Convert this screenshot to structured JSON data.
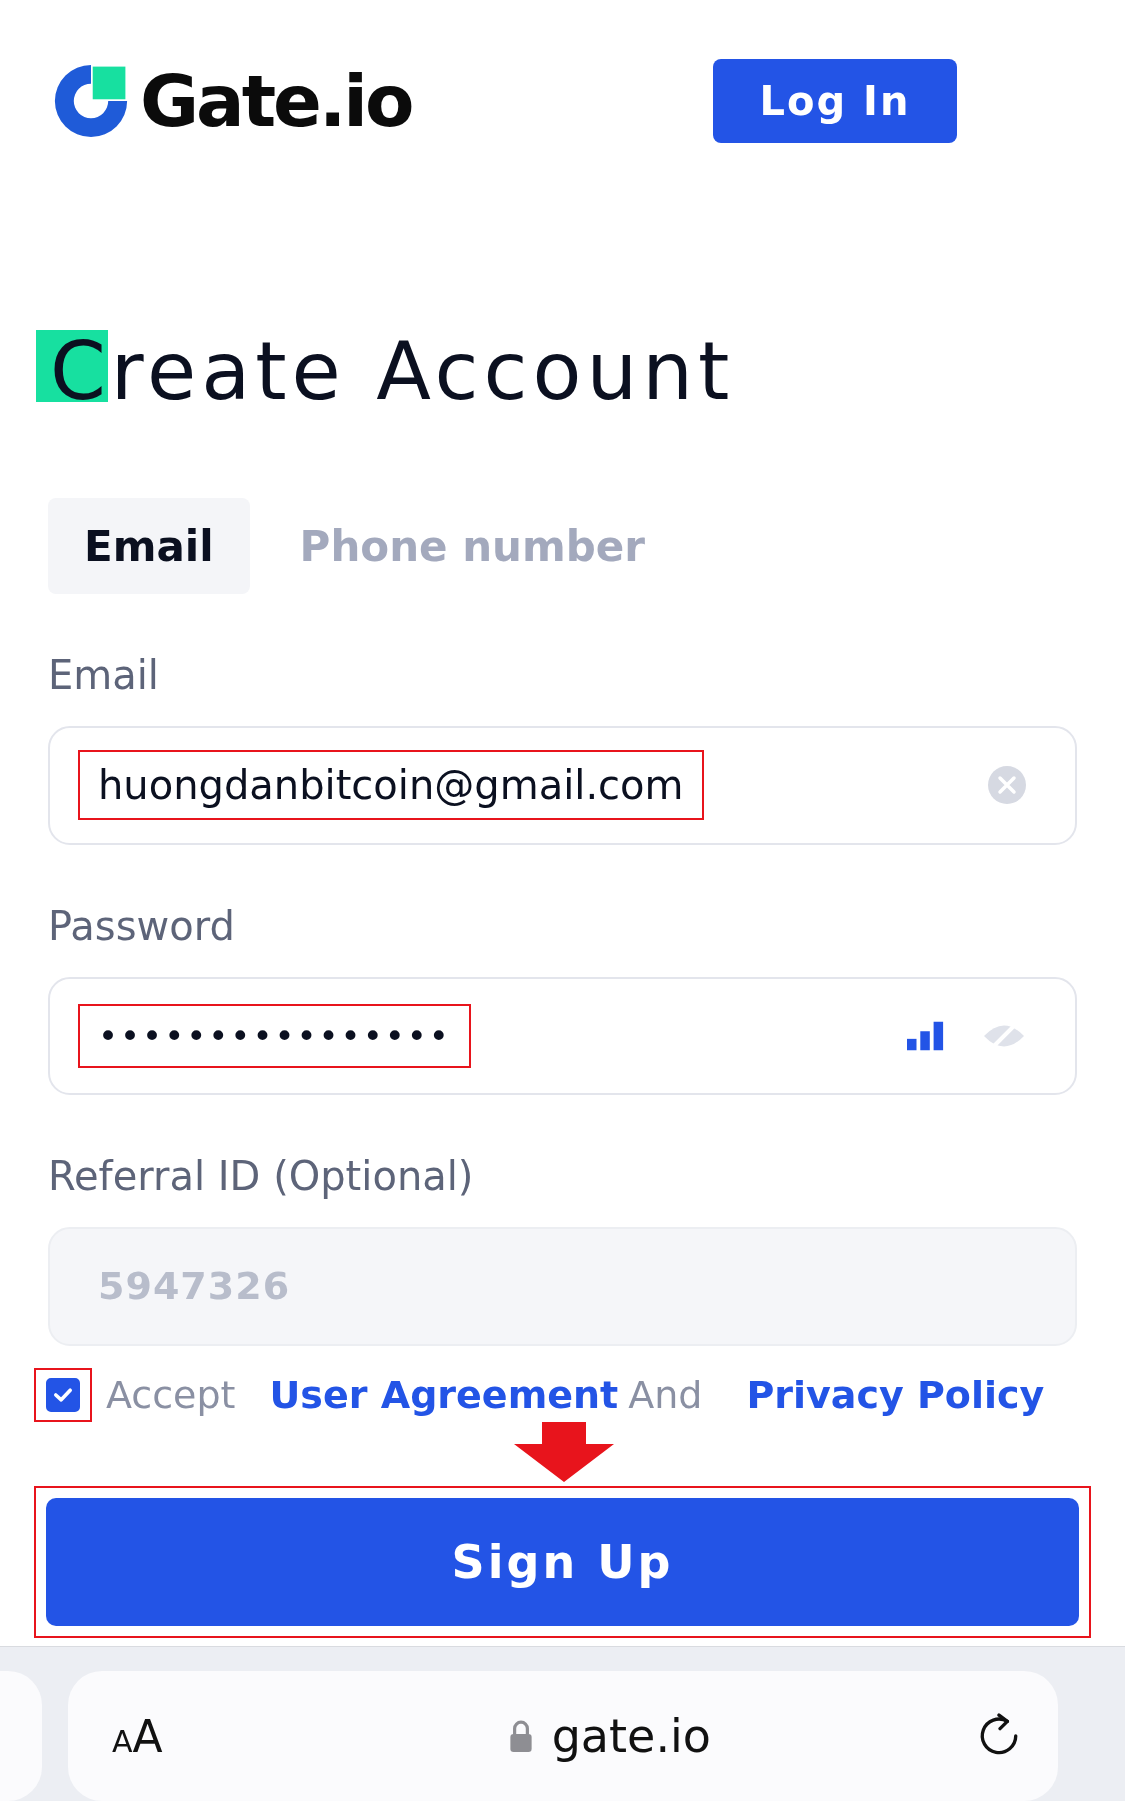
{
  "header": {
    "logo": "Gate.io",
    "login_button": "Log In"
  },
  "title": "Create Account",
  "tabs": [
    {
      "label": "Email",
      "selected": true
    },
    {
      "label": "Phone number",
      "selected": false
    }
  ],
  "fields": [
    {
      "kind": "email",
      "label": "Email",
      "value": "huongdanbitcoin@gmail.com",
      "highlighted": true
    },
    {
      "kind": "password",
      "label": "Password",
      "value": "••••••••••••••••",
      "highlighted": true
    },
    {
      "kind": "referral",
      "label": "Referral ID (Optional)",
      "placeholder": "5947326",
      "highlighted": false
    }
  ],
  "agreement": {
    "checked": true,
    "highlighted": true,
    "prefix": "Accept",
    "link_1": "User Agreement",
    "conjunction": "And",
    "link_2": "Privacy Policy"
  },
  "annotation_arrow": true,
  "sign_up": {
    "label": "Sign Up",
    "highlighted": true
  },
  "browser_bar": {
    "text_size": "AA",
    "url": "gate.io"
  }
}
